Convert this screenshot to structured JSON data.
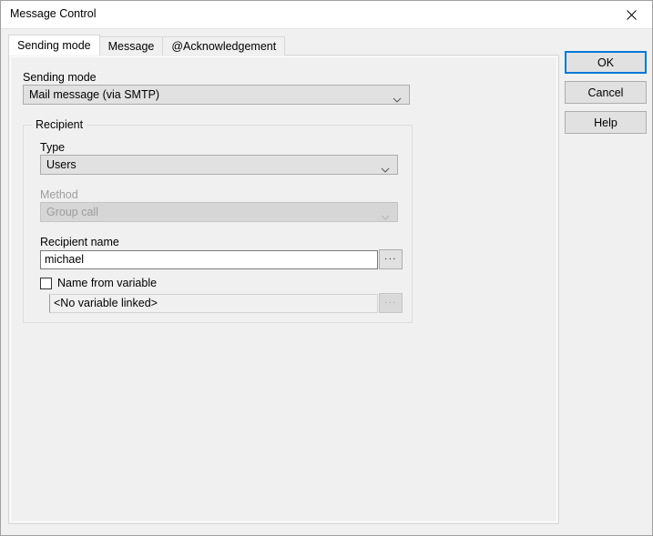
{
  "window": {
    "title": "Message Control",
    "close_icon": "close-icon"
  },
  "tabs": [
    {
      "label": "Sending mode",
      "active": true
    },
    {
      "label": "Message",
      "active": false
    },
    {
      "label": "@Acknowledgement",
      "active": false
    }
  ],
  "sending_mode": {
    "label": "Sending mode",
    "value": "Mail message (via SMTP)",
    "arrow_icon": "chevron-down-icon"
  },
  "recipient_group": {
    "title": "Recipient",
    "type": {
      "label": "Type",
      "value": "Users",
      "arrow_icon": "chevron-down-icon"
    },
    "method": {
      "label": "Method",
      "value": "Group call",
      "arrow_icon": "chevron-down-icon",
      "disabled": true
    },
    "recipient_name": {
      "label": "Recipient name",
      "value": "michael",
      "browse_label": "..."
    },
    "name_from_variable": {
      "label": "Name from variable",
      "checked": false,
      "value": "<No variable linked>",
      "browse_label": "...",
      "disabled": true
    }
  },
  "buttons": {
    "ok": "OK",
    "cancel": "Cancel",
    "help": "Help"
  },
  "colors": {
    "accent": "#0078d7",
    "dialog_bg": "#f0f0f0",
    "titlebar_bg": "#ffffff",
    "control_bg": "#e1e1e1",
    "disabled_text": "#9d9d9d"
  }
}
